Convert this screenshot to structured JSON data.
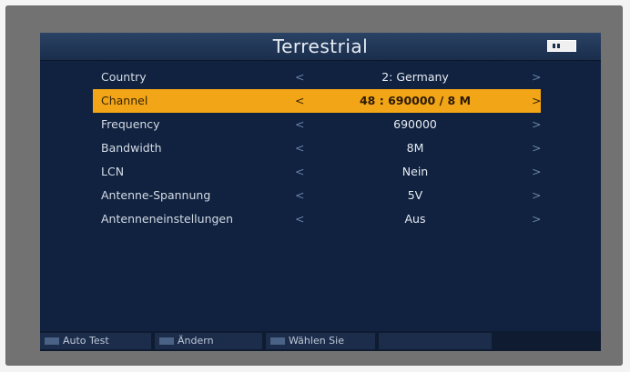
{
  "screen": {
    "title": "Terrestrial",
    "battery_icon": "battery-icon"
  },
  "settings": [
    {
      "label": "Country",
      "value": "2: Germany",
      "selected": false
    },
    {
      "label": "Channel",
      "value": "48 : 690000 / 8 M",
      "selected": true
    },
    {
      "label": "Frequency",
      "value": "690000",
      "selected": false
    },
    {
      "label": "Bandwidth",
      "value": "8M",
      "selected": false
    },
    {
      "label": "LCN",
      "value": "Nein",
      "selected": false
    },
    {
      "label": "Antenne-Spannung",
      "value": "5V",
      "selected": false
    },
    {
      "label": "Antenneneinstellungen",
      "value": "Aus",
      "selected": false
    }
  ],
  "arrows": {
    "left": "<",
    "right": ">"
  },
  "footer": {
    "auto_test": "Auto Test",
    "andern": "Ändern",
    "wahlen": "Wählen Sie"
  },
  "colors": {
    "screen_bg": "#10223f",
    "selection": "#f2a516",
    "bezel": "#727272"
  }
}
